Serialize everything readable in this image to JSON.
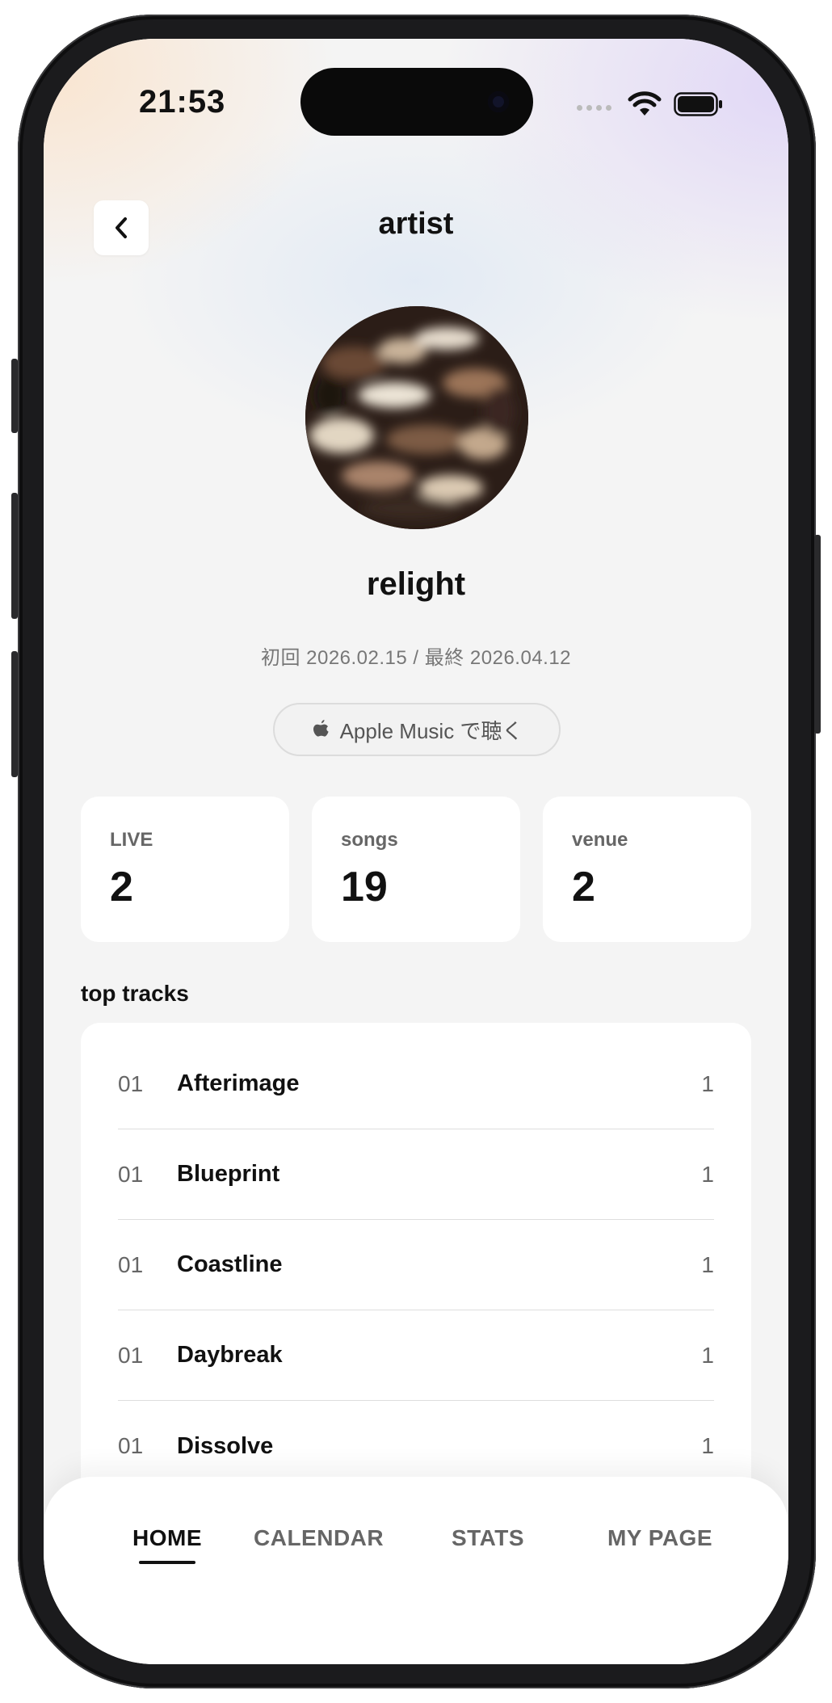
{
  "status_bar": {
    "time": "21:53"
  },
  "header": {
    "title": "artist"
  },
  "artist": {
    "name": "relight",
    "date_range": "初回 2026.02.15 / 最終 2026.04.12",
    "apple_music_label": "Apple Music で聴く"
  },
  "stats": [
    {
      "label": "LIVE",
      "value": "2"
    },
    {
      "label": "songs",
      "value": "19"
    },
    {
      "label": "venue",
      "value": "2"
    }
  ],
  "top_tracks": {
    "title": "top tracks",
    "items": [
      {
        "rank": "01",
        "title": "Afterimage",
        "count": "1"
      },
      {
        "rank": "01",
        "title": "Blueprint",
        "count": "1"
      },
      {
        "rank": "01",
        "title": "Coastline",
        "count": "1"
      },
      {
        "rank": "01",
        "title": "Daybreak",
        "count": "1"
      },
      {
        "rank": "01",
        "title": "Dissolve",
        "count": "1"
      }
    ]
  },
  "tab_bar": {
    "tabs": [
      {
        "label": "HOME",
        "active": true
      },
      {
        "label": "CALENDAR",
        "active": false
      },
      {
        "label": "STATS",
        "active": false
      },
      {
        "label": "MY PAGE",
        "active": false
      }
    ]
  }
}
